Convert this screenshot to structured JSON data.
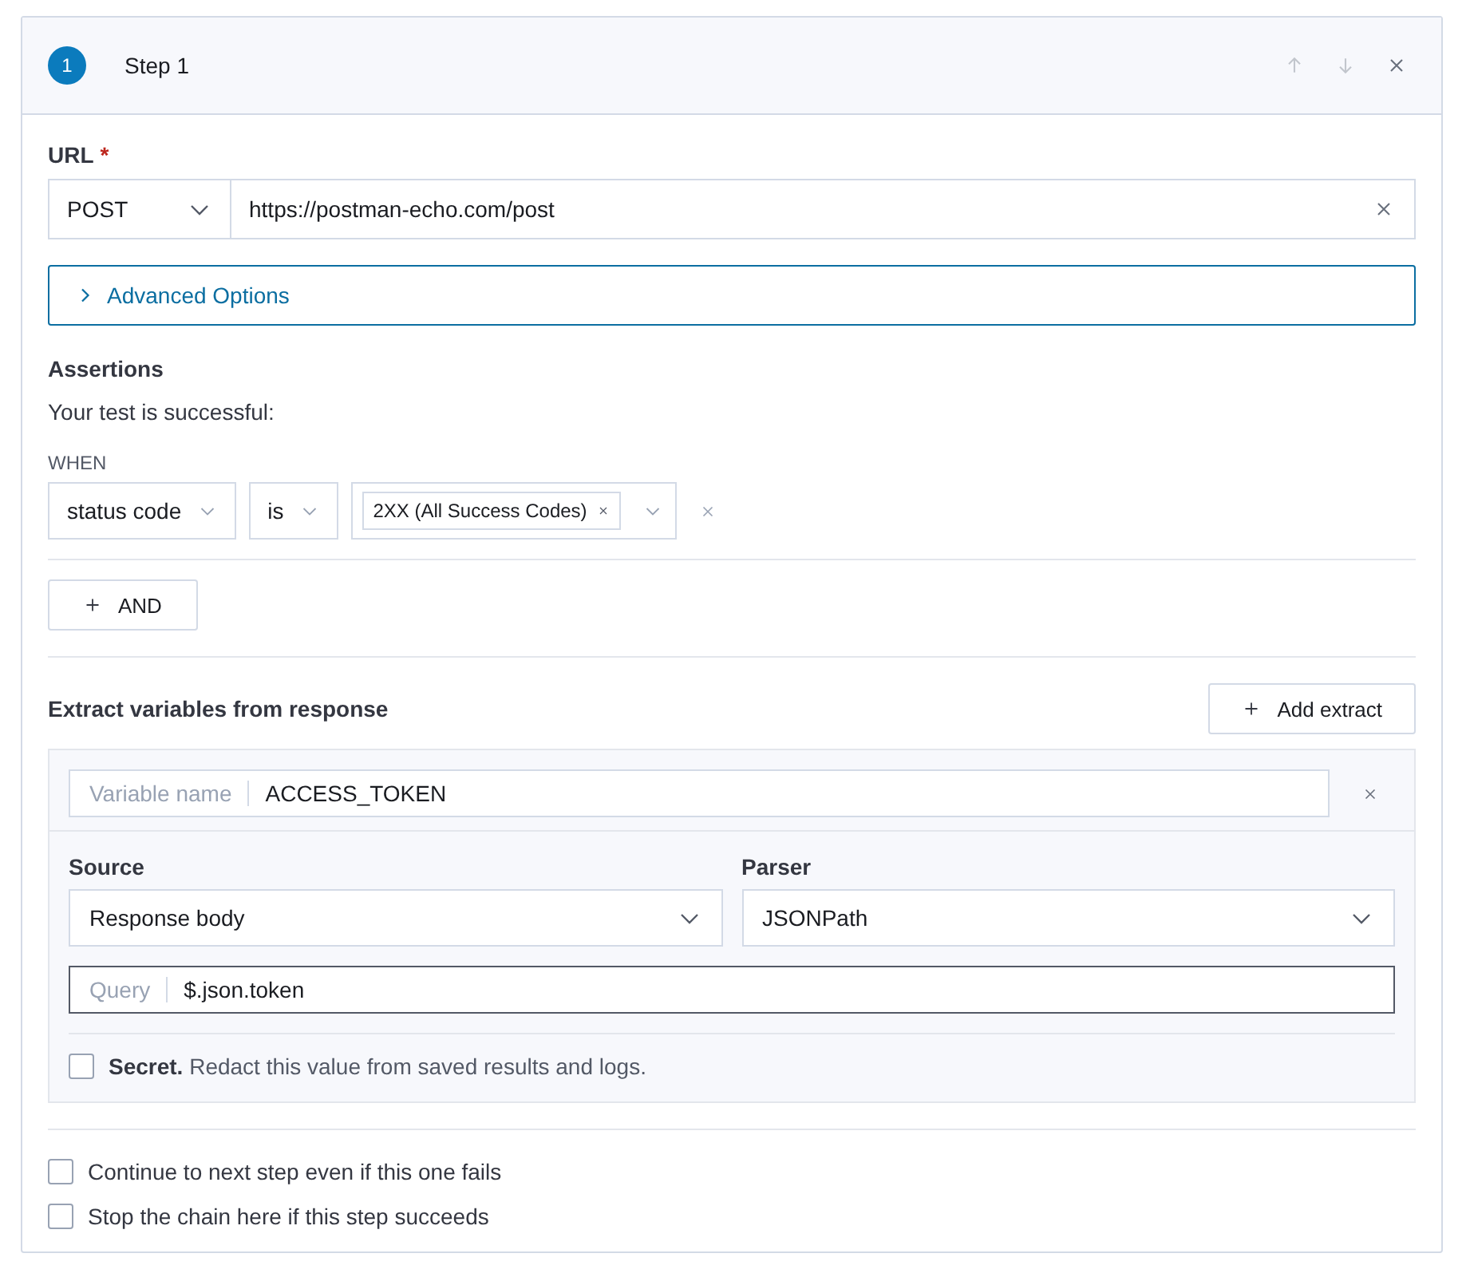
{
  "step": {
    "number": "1",
    "title": "Step 1",
    "actions": [
      {
        "kind": "up",
        "disabled": true
      },
      {
        "kind": "down",
        "disabled": true
      },
      {
        "kind": "close",
        "disabled": false
      }
    ]
  },
  "url": {
    "label": "URL",
    "required_mark": "*",
    "method": "POST",
    "value": "https://postman-echo.com/post"
  },
  "advanced": {
    "label": "Advanced Options",
    "expanded": false
  },
  "assertions": {
    "title": "Assertions",
    "subtitle": "Your test is successful:",
    "when": "WHEN",
    "condition": {
      "field": "status code",
      "operator": "is",
      "tags": [
        "2XX (All Success Codes)"
      ]
    },
    "and_button": "AND"
  },
  "extract": {
    "title": "Extract variables from response",
    "add_button": "Add extract",
    "items": [
      {
        "variable_placeholder": "Variable name",
        "variable": "ACCESS_TOKEN",
        "source_label": "Source",
        "source": "Response body",
        "parser_label": "Parser",
        "parser": "JSONPath",
        "query_placeholder": "Query",
        "query": "$.json.token",
        "secret": {
          "text": "**Secret.** Redact this value from saved results and logs.",
          "checked": false
        }
      }
    ]
  },
  "options": [
    {
      "label": "Continue to next step even if this one fails",
      "checked": false
    },
    {
      "label": "Stop the chain here if this step succeeds",
      "checked": false
    }
  ]
}
